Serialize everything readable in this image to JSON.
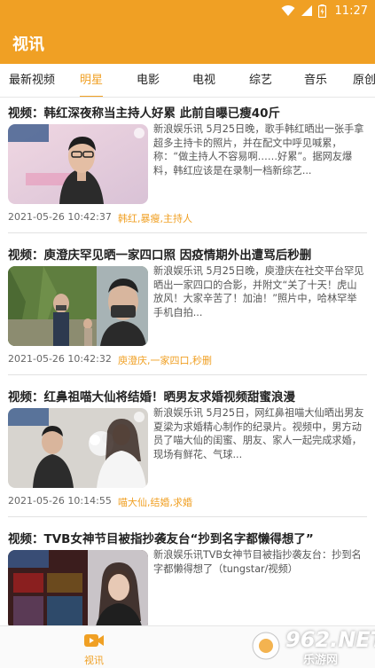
{
  "status_bar": {
    "time": "11:27"
  },
  "header": {
    "title": "视讯"
  },
  "tabs": [
    {
      "label": "最新视频"
    },
    {
      "label": "明星",
      "active": true
    },
    {
      "label": "电影"
    },
    {
      "label": "电视"
    },
    {
      "label": "综艺"
    },
    {
      "label": "音乐"
    },
    {
      "label": "原创"
    }
  ],
  "articles": [
    {
      "title": "视频：韩红深夜称当主持人好累 此前自曝已瘦40斤",
      "summary": "新浪娱乐讯 5月25日晚，歌手韩红晒出一张手拿超多主持卡的照片，并在配文中呼见喊累，称：“做主持人不容易啊……好累”。据网友爆料，韩红应该是在录制一档新综艺...",
      "time": "2021-05-26 10:42:37",
      "tags": "韩红,暴瘦,主持人"
    },
    {
      "title": "视频：庾澄庆罕见晒一家四口照 因疫情期外出遭骂后秒删",
      "summary": "新浪娱乐讯 5月25日晚，庾澄庆在社交平台罕见晒出一家四口的合影，并附文“关了十天！虎山放风！大家辛苦了！加油！”照片中，哈林罕举手机自拍...",
      "time": "2021-05-26 10:42:32",
      "tags": "庾澄庆,一家四口,秒删"
    },
    {
      "title": "视频：红鼻祖喵大仙将结婚！晒男友求婚视频甜蜜浪漫",
      "summary": "新浪娱乐讯 5月25日，网红鼻祖喵大仙晒出男友夏梁为求婚精心制作的纪录片。视频中，男方动员了喵大仙的闺蜜、朋友、家人一起完成求婚，现场有鲜花、气球...",
      "time": "2021-05-26 10:14:55",
      "tags": "喵大仙,结婚,求婚"
    },
    {
      "title": "视频：TVB女神节目被指抄袭友台“抄到名字都懒得想了”",
      "summary": "新浪娱乐讯TVB女神节目被指抄袭友台：抄到名字都懒得想了（tungstar/视频）",
      "time": "",
      "tags": ""
    }
  ],
  "bottom_nav": {
    "label": "视讯"
  },
  "watermark": {
    "text": "962.NET",
    "sub": "乐游网"
  },
  "colors": {
    "accent": "#f0a024"
  }
}
